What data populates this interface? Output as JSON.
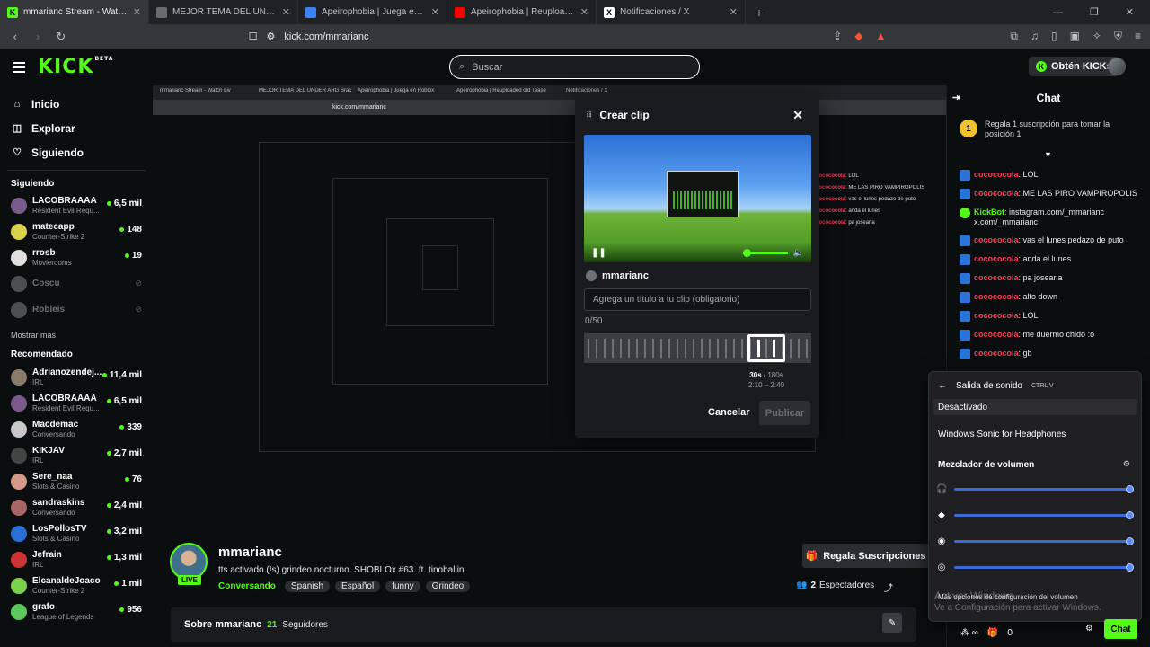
{
  "browser": {
    "tabs": [
      {
        "title": "mmarianc Stream - Watch Liv",
        "fav": "K",
        "color": "#53fc18"
      },
      {
        "title": "MEJOR TEMA DEL UNDER ARG Brac",
        "fav": "",
        "color": "#6b6b6b"
      },
      {
        "title": "Apeirophobia | Juega en Roblox",
        "fav": "",
        "color": "#3b82f6"
      },
      {
        "title": "Apeirophobia | Reuploaded old Tease",
        "fav": "",
        "color": "#ff0000"
      },
      {
        "title": "Notificaciones / X",
        "fav": "X",
        "color": "#ffffff"
      }
    ],
    "url": "kick.com/mmarianc"
  },
  "header": {
    "logo": "KICK",
    "logo_beta": "BETA",
    "search_placeholder": "Buscar",
    "kicks_button": "Obtén KICKs"
  },
  "sidebar": {
    "nav": [
      {
        "label": "Inicio",
        "icon": "home-icon"
      },
      {
        "label": "Explorar",
        "icon": "compass-icon"
      },
      {
        "label": "Siguiendo",
        "icon": "heart-icon"
      }
    ],
    "following_title": "Siguiendo",
    "following": [
      {
        "name": "LACOBRAAAA",
        "category": "Resident Evil Requ...",
        "viewers": "6,5 mil",
        "live": true,
        "color": "#7a5a8a"
      },
      {
        "name": "matecapp",
        "category": "Counter-Strike 2",
        "viewers": "148",
        "live": true,
        "color": "#d9d24a"
      },
      {
        "name": "rrosb",
        "category": "Movierooms",
        "viewers": "19",
        "live": true,
        "color": "#e0e0e0"
      },
      {
        "name": "Coscu",
        "category": "",
        "viewers": "",
        "live": false,
        "color": "#8b8f94"
      },
      {
        "name": "Robleis",
        "category": "",
        "viewers": "",
        "live": false,
        "color": "#8b8f94"
      }
    ],
    "show_more": "Mostrar más",
    "recommended_title": "Recomendado",
    "recommended": [
      {
        "name": "Adrianozendej...",
        "category": "IRL",
        "viewers": "11,4 mil",
        "color": "#8a7a6a"
      },
      {
        "name": "LACOBRAAAA",
        "category": "Resident Evil Requ...",
        "viewers": "6,5 mil",
        "color": "#7a5a8a"
      },
      {
        "name": "Macdemac",
        "category": "Conversando",
        "viewers": "339",
        "color": "#c8c8c8"
      },
      {
        "name": "KIKJAV",
        "category": "IRL",
        "viewers": "2,7 mil",
        "color": "#444"
      },
      {
        "name": "Sere_naa",
        "category": "Slots & Casino",
        "viewers": "76",
        "color": "#d79a8a"
      },
      {
        "name": "sandraskins",
        "category": "Conversando",
        "viewers": "2,4 mil",
        "color": "#a66"
      },
      {
        "name": "LosPollosTV",
        "category": "Slots & Casino",
        "viewers": "3,2 mil",
        "color": "#2a6fd6"
      },
      {
        "name": "Jefrain",
        "category": "IRL",
        "viewers": "1,3 mil",
        "color": "#c33"
      },
      {
        "name": "ElcanaldeJoaco",
        "category": "Counter-Strike 2",
        "viewers": "1 mil",
        "color": "#7bd14a"
      },
      {
        "name": "grafo",
        "category": "League of Legends",
        "viewers": "956",
        "color": "#5ac85a"
      }
    ]
  },
  "clip_modal": {
    "title": "Crear clip",
    "user": "mmarianc",
    "title_placeholder": "Agrega un título a tu clip (obligatorio)",
    "char_count": "0/50",
    "duration_sel": "30s",
    "duration_max": "/ 180s",
    "range": "2:10 – 2:40",
    "cancel": "Cancelar",
    "publish": "Publicar"
  },
  "stream": {
    "username": "mmarianc",
    "live": "LIVE",
    "title": "tts activado (!s) grindeo nocturno. SHOBLOx #63. ft. tinoballin",
    "category": "Conversando",
    "tags": [
      "Spanish",
      "Español",
      "funny",
      "Grindeo"
    ],
    "subs_button": "Regala Suscripciones",
    "viewers_count": "2",
    "viewers_label": "Espectadores",
    "about": "Sobre mmarianc",
    "followers_count": "21",
    "followers_label": "Seguidores"
  },
  "chat": {
    "title": "Chat",
    "gift_coin": "1",
    "gift_text": "Regala 1 suscripción para tomar la posición 1",
    "messages": [
      {
        "user": "cocococola",
        "text": ": LOL",
        "bot": false
      },
      {
        "user": "cocococola",
        "text": ": ME LAS PIRO VAMPIROPOLIS",
        "bot": false
      },
      {
        "user": "KickBot",
        "text": ": instagram.com/_mmarianc x.com/_mmarianc",
        "bot": true
      },
      {
        "user": "cocococola",
        "text": ": vas el lunes pedazo de puto",
        "bot": false
      },
      {
        "user": "cocococola",
        "text": ": anda el lunes",
        "bot": false
      },
      {
        "user": "cocococola",
        "text": ": pa josearla",
        "bot": false
      },
      {
        "user": "cocococola",
        "text": ": alto down",
        "bot": false
      },
      {
        "user": "cocococola",
        "text": ": LOL",
        "bot": false
      },
      {
        "user": "cocococola",
        "text": ": me duermo chido :o",
        "bot": false
      },
      {
        "user": "cocococola",
        "text": ": gb",
        "bot": false
      }
    ],
    "footer_count": "0",
    "send": "Chat"
  },
  "sound_panel": {
    "title": "Salida de sonido",
    "shortcut": "CTRL V",
    "devices": [
      "Desactivado",
      "Windows Sonic for Headphones"
    ],
    "mixer_title": "Mezclador de volumen",
    "mixer_rows": [
      {
        "icon": "headphones-icon",
        "level": 0.98
      },
      {
        "icon": "brave-icon",
        "level": 0.98
      },
      {
        "icon": "discord-icon",
        "level": 0.98
      },
      {
        "icon": "obs-icon",
        "level": 0.98
      }
    ],
    "more": "Más opciones de configuración del volumen"
  },
  "watermark": {
    "line1": "Activar Windows",
    "line2": "Ve a Configuración para activar Windows."
  }
}
